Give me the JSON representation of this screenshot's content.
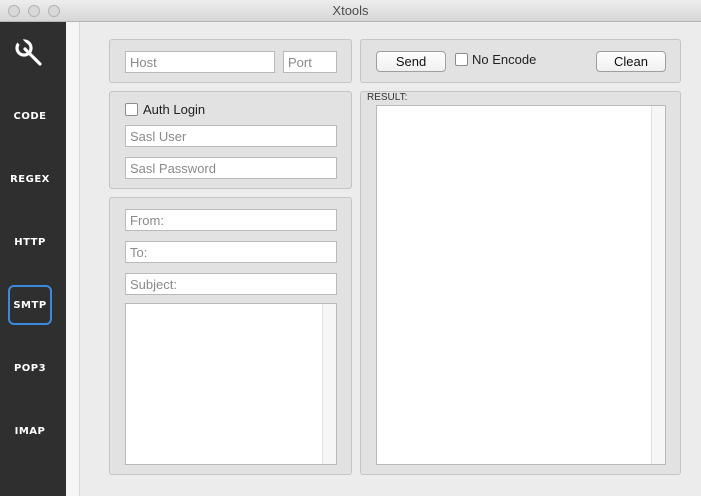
{
  "window": {
    "title": "Xtools"
  },
  "sidebar": {
    "items": [
      {
        "label": "CODE"
      },
      {
        "label": "REGEX"
      },
      {
        "label": "HTTP"
      },
      {
        "label": "SMTP",
        "active": true
      },
      {
        "label": "POP3"
      },
      {
        "label": "IMAP"
      }
    ]
  },
  "connection": {
    "host_placeholder": "Host",
    "port_placeholder": "Port"
  },
  "auth": {
    "auth_login_label": "Auth Login",
    "sasl_user_placeholder": "Sasl User",
    "sasl_password_placeholder": "Sasl Password"
  },
  "message": {
    "from_placeholder": "From:",
    "to_placeholder": "To:",
    "subject_placeholder": "Subject:"
  },
  "toolbar": {
    "send_label": "Send",
    "no_encode_label": "No Encode",
    "clean_label": "Clean"
  },
  "result": {
    "label": "RESULT:"
  },
  "colors": {
    "sidebar_bg": "#2f2f2f",
    "active_border": "#3a8be0"
  }
}
